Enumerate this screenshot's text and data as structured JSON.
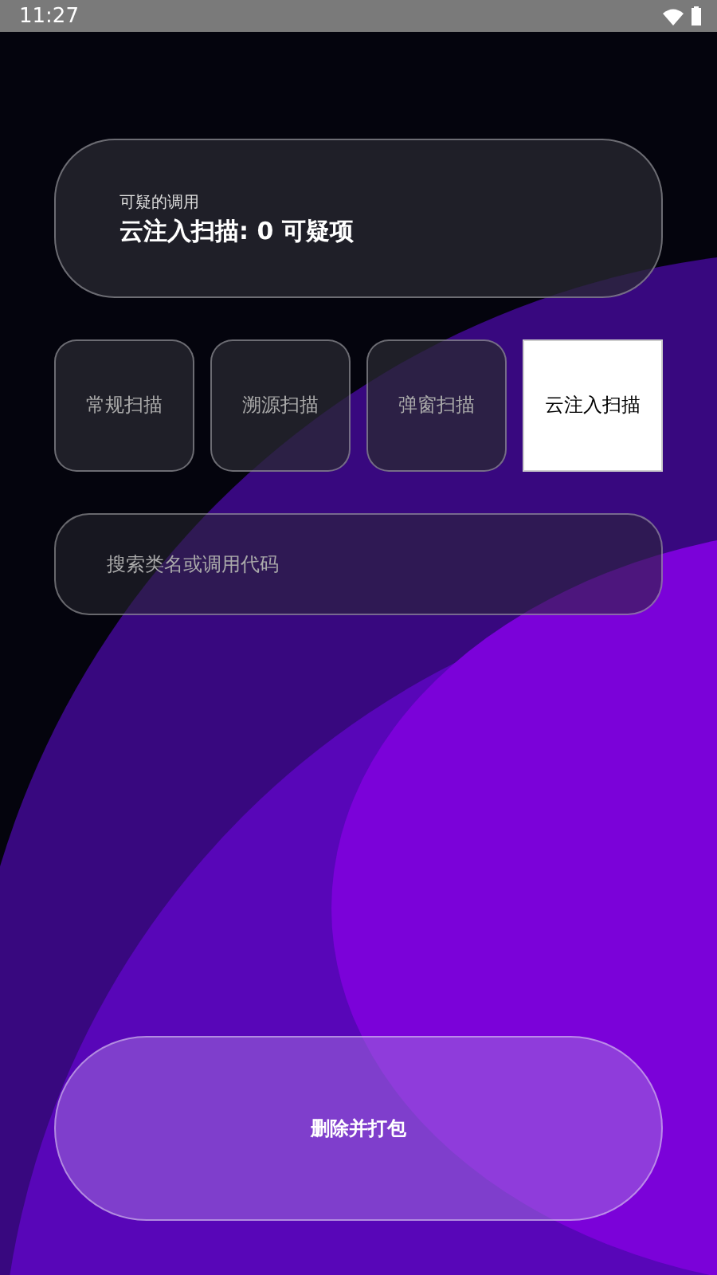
{
  "status_bar": {
    "time": "11:27"
  },
  "summary": {
    "caption": "可疑的调用",
    "headline": "云注入扫描: 0 可疑项"
  },
  "tabs": [
    {
      "label": "常规扫描",
      "selected": false
    },
    {
      "label": "溯源扫描",
      "selected": false
    },
    {
      "label": "弹窗扫描",
      "selected": false
    },
    {
      "label": "云注入扫描",
      "selected": true
    }
  ],
  "search": {
    "placeholder": "搜索类名或调用代码"
  },
  "action_button": {
    "label": "删除并打包"
  }
}
